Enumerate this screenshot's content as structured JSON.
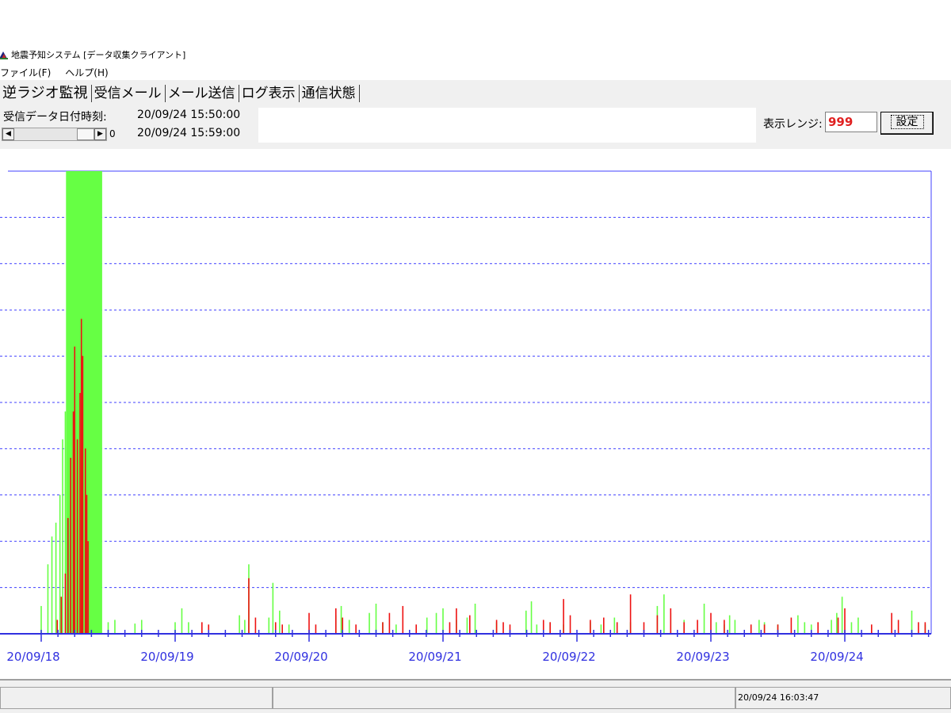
{
  "window": {
    "title": "地震予知システム [データ収集クライアント]",
    "icon": "app-icon"
  },
  "menu": {
    "items": [
      "ファイル(F)",
      "ヘルプ(H)"
    ]
  },
  "tabs": [
    {
      "label": "逆ラジオ監視",
      "active": true
    },
    {
      "label": "受信メール",
      "active": false
    },
    {
      "label": "メール送信",
      "active": false
    },
    {
      "label": "ログ表示",
      "active": false
    },
    {
      "label": "通信状態",
      "active": false
    }
  ],
  "info": {
    "received_label": "受信データ日付時刻:",
    "time_start": "20/09/24 15:50:00",
    "time_end": "20/09/24 15:59:00",
    "scroll_value": "0"
  },
  "range": {
    "label": "表示レンジ:",
    "value": "999",
    "button_label": "設定"
  },
  "status": {
    "timestamp": "20/09/24 16:03:47"
  },
  "colors": {
    "grid_blue": "#4040ff",
    "axis_blue": "#3030e0",
    "green": "#66ff44",
    "red": "#ee1111",
    "range_red": "#e02020"
  },
  "chart_data": {
    "type": "bar",
    "x_labels": [
      "20/09/18",
      "20/09/19",
      "20/09/20",
      "20/09/21",
      "20/09/22",
      "20/09/23",
      "20/09/24"
    ],
    "ylim": [
      0,
      999
    ],
    "grid": true,
    "highlight_band": {
      "from_day": 0.12,
      "to_day": 0.39
    },
    "series": [
      {
        "color": "green",
        "points": [
          [
            0.0,
            60
          ],
          [
            0.05,
            150
          ],
          [
            0.08,
            210
          ],
          [
            0.11,
            240
          ],
          [
            0.14,
            300
          ],
          [
            0.16,
            420
          ],
          [
            0.18,
            480
          ],
          [
            0.2,
            600
          ],
          [
            0.22,
            580
          ],
          [
            0.24,
            700
          ],
          [
            0.26,
            750
          ],
          [
            0.28,
            650
          ],
          [
            0.3,
            560
          ],
          [
            0.32,
            380
          ],
          [
            0.34,
            300
          ],
          [
            0.36,
            520
          ],
          [
            0.38,
            600
          ],
          [
            0.43,
            10
          ],
          [
            0.5,
            25
          ],
          [
            0.55,
            30
          ],
          [
            0.7,
            22
          ],
          [
            0.75,
            30
          ],
          [
            1.0,
            25
          ],
          [
            1.05,
            55
          ],
          [
            1.1,
            25
          ],
          [
            1.48,
            40
          ],
          [
            1.52,
            30
          ],
          [
            1.55,
            150
          ],
          [
            1.7,
            35
          ],
          [
            1.73,
            110
          ],
          [
            1.78,
            50
          ],
          [
            1.85,
            20
          ],
          [
            2.2,
            40
          ],
          [
            2.24,
            60
          ],
          [
            2.3,
            30
          ],
          [
            2.45,
            45
          ],
          [
            2.5,
            65
          ],
          [
            2.55,
            25
          ],
          [
            2.65,
            20
          ],
          [
            2.88,
            35
          ],
          [
            2.95,
            45
          ],
          [
            3.0,
            55
          ],
          [
            3.1,
            30
          ],
          [
            3.18,
            35
          ],
          [
            3.24,
            65
          ],
          [
            3.4,
            25
          ],
          [
            3.62,
            50
          ],
          [
            3.66,
            70
          ],
          [
            3.7,
            20
          ],
          [
            3.8,
            25
          ],
          [
            3.9,
            20
          ],
          [
            4.1,
            25
          ],
          [
            4.18,
            20
          ],
          [
            4.28,
            35
          ],
          [
            4.4,
            25
          ],
          [
            4.6,
            60
          ],
          [
            4.65,
            85
          ],
          [
            4.7,
            45
          ],
          [
            4.8,
            30
          ],
          [
            4.95,
            65
          ],
          [
            5.04,
            25
          ],
          [
            5.1,
            20
          ],
          [
            5.14,
            40
          ],
          [
            5.18,
            30
          ],
          [
            5.36,
            30
          ],
          [
            5.4,
            25
          ],
          [
            5.5,
            20
          ],
          [
            5.65,
            40
          ],
          [
            5.7,
            25
          ],
          [
            5.75,
            20
          ],
          [
            5.9,
            30
          ],
          [
            5.94,
            45
          ],
          [
            5.98,
            80
          ],
          [
            6.05,
            25
          ],
          [
            6.1,
            35
          ],
          [
            6.5,
            50
          ],
          [
            6.6,
            20
          ],
          [
            6.8,
            25
          ],
          [
            6.98,
            125
          ],
          [
            7.02,
            140
          ],
          [
            7.05,
            60
          ],
          [
            7.12,
            20
          ],
          [
            7.28,
            40
          ],
          [
            7.32,
            50
          ],
          [
            7.36,
            30
          ],
          [
            7.45,
            25
          ],
          [
            7.58,
            30
          ],
          [
            7.62,
            60
          ],
          [
            7.66,
            55
          ],
          [
            7.7,
            40
          ],
          [
            7.75,
            35
          ],
          [
            8.05,
            60
          ],
          [
            8.1,
            35
          ],
          [
            8.3,
            25
          ]
        ]
      },
      {
        "color": "red",
        "points": [
          [
            0.12,
            30
          ],
          [
            0.15,
            80
          ],
          [
            0.18,
            130
          ],
          [
            0.2,
            250
          ],
          [
            0.22,
            380
          ],
          [
            0.24,
            480
          ],
          [
            0.25,
            620
          ],
          [
            0.27,
            420
          ],
          [
            0.29,
            520
          ],
          [
            0.3,
            680
          ],
          [
            0.31,
            600
          ],
          [
            0.33,
            400
          ],
          [
            0.34,
            300
          ],
          [
            0.35,
            200
          ],
          [
            1.2,
            25
          ],
          [
            1.25,
            20
          ],
          [
            1.55,
            120
          ],
          [
            1.6,
            35
          ],
          [
            1.75,
            25
          ],
          [
            1.8,
            20
          ],
          [
            2.0,
            45
          ],
          [
            2.05,
            20
          ],
          [
            2.2,
            55
          ],
          [
            2.25,
            35
          ],
          [
            2.35,
            20
          ],
          [
            2.55,
            25
          ],
          [
            2.6,
            45
          ],
          [
            2.7,
            60
          ],
          [
            2.8,
            20
          ],
          [
            3.05,
            25
          ],
          [
            3.1,
            55
          ],
          [
            3.2,
            40
          ],
          [
            3.4,
            30
          ],
          [
            3.45,
            25
          ],
          [
            3.5,
            20
          ],
          [
            3.75,
            30
          ],
          [
            3.8,
            25
          ],
          [
            3.9,
            75
          ],
          [
            3.95,
            40
          ],
          [
            4.1,
            30
          ],
          [
            4.2,
            35
          ],
          [
            4.3,
            25
          ],
          [
            4.4,
            85
          ],
          [
            4.5,
            25
          ],
          [
            4.6,
            40
          ],
          [
            4.7,
            55
          ],
          [
            4.8,
            25
          ],
          [
            4.9,
            30
          ],
          [
            5.0,
            45
          ],
          [
            5.1,
            30
          ],
          [
            5.3,
            20
          ],
          [
            5.4,
            20
          ],
          [
            5.5,
            20
          ],
          [
            5.6,
            35
          ],
          [
            5.8,
            25
          ],
          [
            5.95,
            35
          ],
          [
            6.0,
            55
          ],
          [
            6.2,
            20
          ],
          [
            6.35,
            45
          ],
          [
            6.4,
            30
          ],
          [
            6.55,
            25
          ],
          [
            6.6,
            25
          ],
          [
            6.75,
            30
          ],
          [
            6.85,
            25
          ],
          [
            6.88,
            45
          ],
          [
            6.92,
            25
          ],
          [
            7.05,
            20
          ],
          [
            7.15,
            25
          ],
          [
            7.3,
            40
          ],
          [
            7.35,
            55
          ],
          [
            7.38,
            65
          ],
          [
            7.42,
            45
          ],
          [
            7.5,
            30
          ],
          [
            7.55,
            55
          ],
          [
            7.6,
            120
          ],
          [
            7.62,
            45
          ],
          [
            7.7,
            25
          ],
          [
            8.02,
            30
          ],
          [
            8.06,
            25
          ]
        ]
      }
    ]
  }
}
